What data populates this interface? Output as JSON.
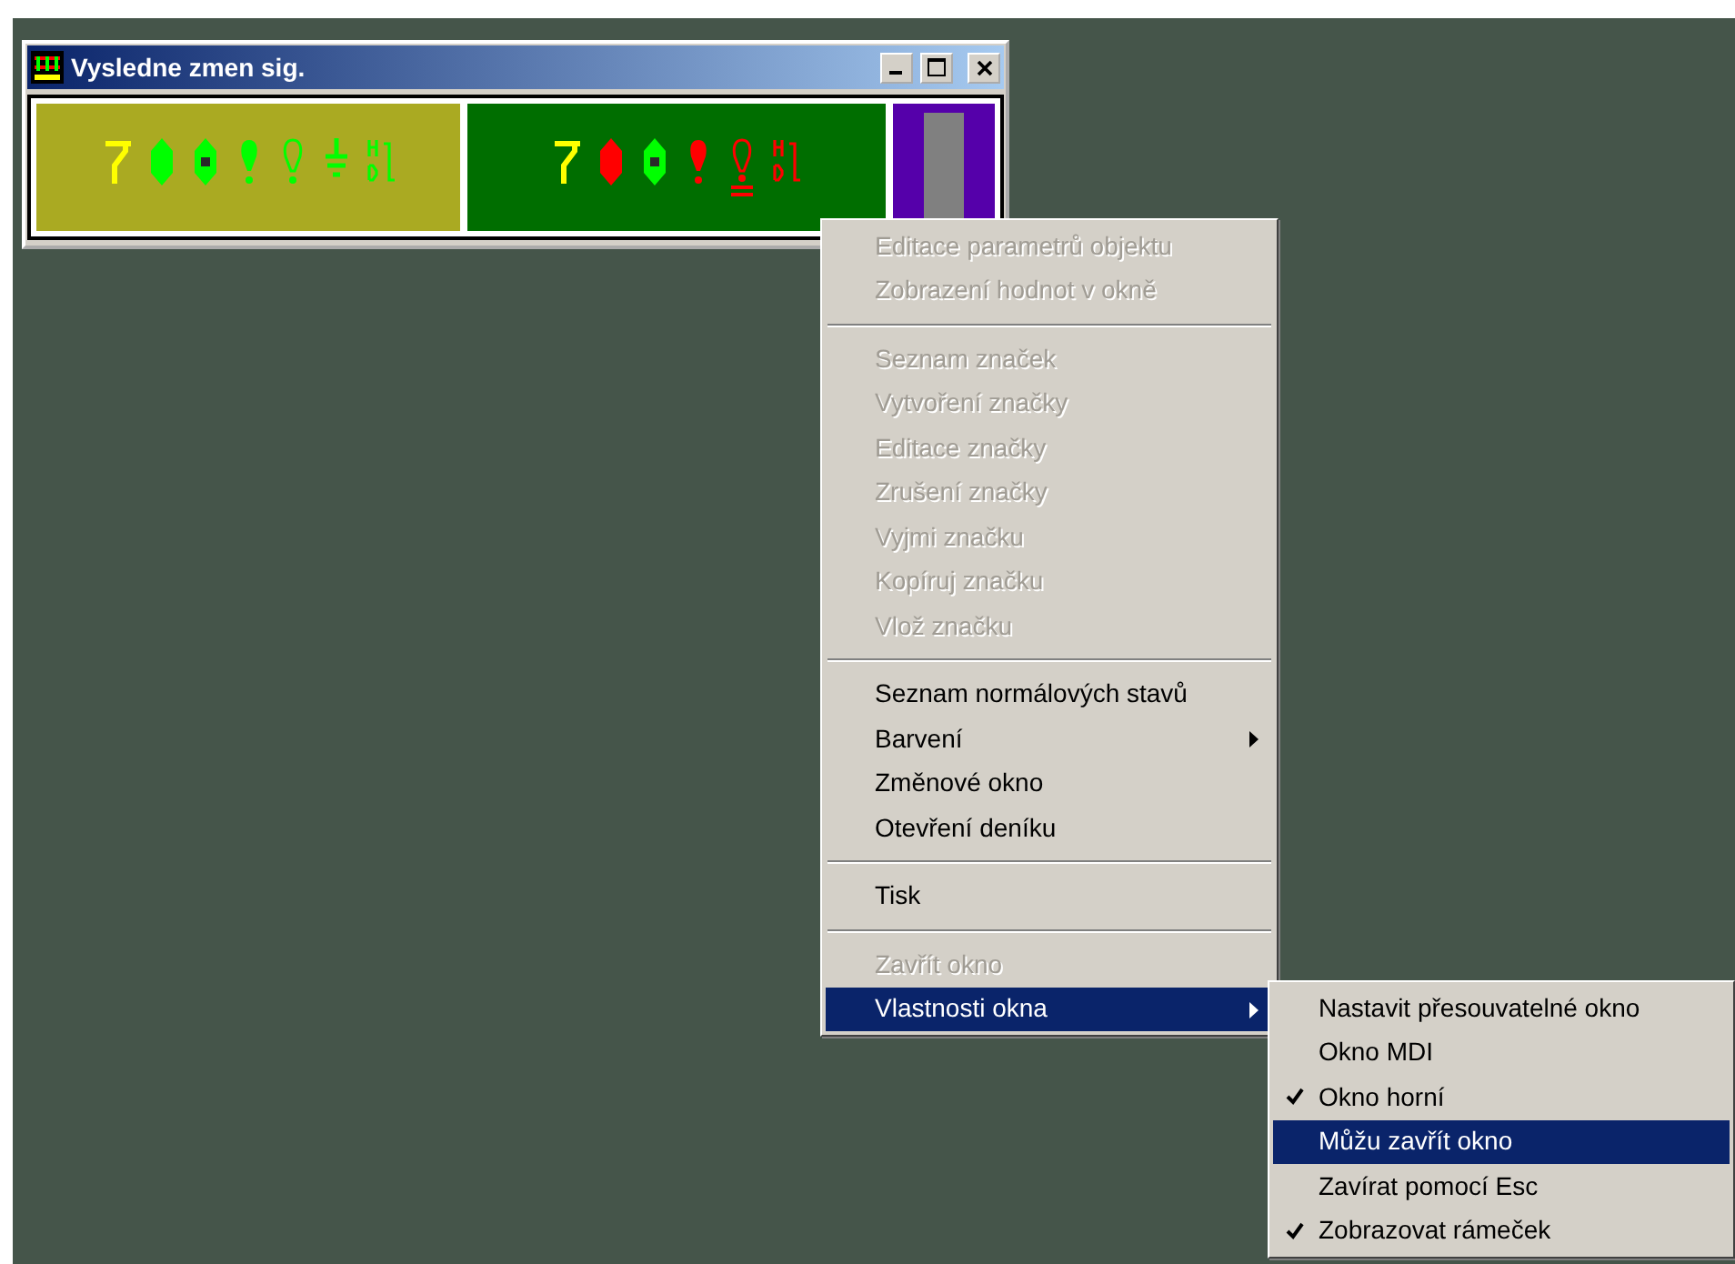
{
  "window": {
    "title": "Vysledne zmen sig.",
    "panels": [
      {
        "color": "#aaaa22",
        "symbols": [
          {
            "kind": "lever",
            "color": "#ffff00"
          },
          {
            "kind": "block-filled",
            "color": "#00ff00"
          },
          {
            "kind": "block-hollow",
            "color": "#00ff00"
          },
          {
            "kind": "bulb-filled",
            "color": "#00ff00"
          },
          {
            "kind": "bulb-outline",
            "color": "#00ff00"
          },
          {
            "kind": "ground",
            "color": "#00ff00"
          },
          {
            "kind": "bracket",
            "color": "#00ff00"
          }
        ]
      },
      {
        "color": "#006e00",
        "symbols": [
          {
            "kind": "lever",
            "color": "#ffff00"
          },
          {
            "kind": "block-filled",
            "color": "#ff0000"
          },
          {
            "kind": "block-hollow",
            "color": "#00ff00"
          },
          {
            "kind": "bulb-filled",
            "color": "#ff0000"
          },
          {
            "kind": "bulb-barred",
            "color": "#ff0000"
          },
          {
            "kind": "bracket",
            "color": "#ff0000"
          }
        ]
      },
      {
        "color": "#5500aa",
        "symbols": [
          {
            "kind": "gray-block",
            "color": "#808080"
          }
        ]
      }
    ]
  },
  "context_menu": {
    "items": [
      {
        "kind": "item",
        "label": "Editace parametrů objektu",
        "disabled": true,
        "submenu": false,
        "selected": false
      },
      {
        "kind": "item",
        "label": "Zobrazení hodnot v okně",
        "disabled": true,
        "submenu": false,
        "selected": false
      },
      {
        "kind": "separator"
      },
      {
        "kind": "item",
        "label": "Seznam značek",
        "disabled": true,
        "submenu": false,
        "selected": false
      },
      {
        "kind": "item",
        "label": "Vytvoření značky",
        "disabled": true,
        "submenu": false,
        "selected": false
      },
      {
        "kind": "item",
        "label": "Editace značky",
        "disabled": true,
        "submenu": false,
        "selected": false
      },
      {
        "kind": "item",
        "label": "Zrušení značky",
        "disabled": true,
        "submenu": false,
        "selected": false
      },
      {
        "kind": "item",
        "label": "Vyjmi značku",
        "disabled": true,
        "submenu": false,
        "selected": false
      },
      {
        "kind": "item",
        "label": "Kopíruj značku",
        "disabled": true,
        "submenu": false,
        "selected": false
      },
      {
        "kind": "item",
        "label": "Vlož značku",
        "disabled": true,
        "submenu": false,
        "selected": false
      },
      {
        "kind": "separator"
      },
      {
        "kind": "item",
        "label": "Seznam normálových stavů",
        "disabled": false,
        "submenu": false,
        "selected": false
      },
      {
        "kind": "item",
        "label": "Barvení",
        "disabled": false,
        "submenu": true,
        "selected": false
      },
      {
        "kind": "item",
        "label": "Změnové okno",
        "disabled": false,
        "submenu": false,
        "selected": false
      },
      {
        "kind": "item",
        "label": "Otevření deníku",
        "disabled": false,
        "submenu": false,
        "selected": false
      },
      {
        "kind": "separator"
      },
      {
        "kind": "item",
        "label": "Tisk",
        "disabled": false,
        "submenu": false,
        "selected": false
      },
      {
        "kind": "separator"
      },
      {
        "kind": "item",
        "label": "Zavřít okno",
        "disabled": true,
        "submenu": false,
        "selected": false
      },
      {
        "kind": "item",
        "label": "Vlastnosti okna",
        "disabled": false,
        "submenu": true,
        "selected": true
      }
    ]
  },
  "submenu": {
    "items": [
      {
        "label": "Nastavit přesouvatelné okno",
        "checked": false,
        "selected": false
      },
      {
        "label": "Okno MDI",
        "checked": false,
        "selected": false
      },
      {
        "label": "Okno horní",
        "checked": true,
        "selected": false
      },
      {
        "label": "Můžu zavřít okno",
        "checked": false,
        "selected": true
      },
      {
        "label": "Zavírat pomocí Esc",
        "checked": false,
        "selected": false
      },
      {
        "label": "Zobrazovat rámeček",
        "checked": true,
        "selected": false
      }
    ]
  }
}
